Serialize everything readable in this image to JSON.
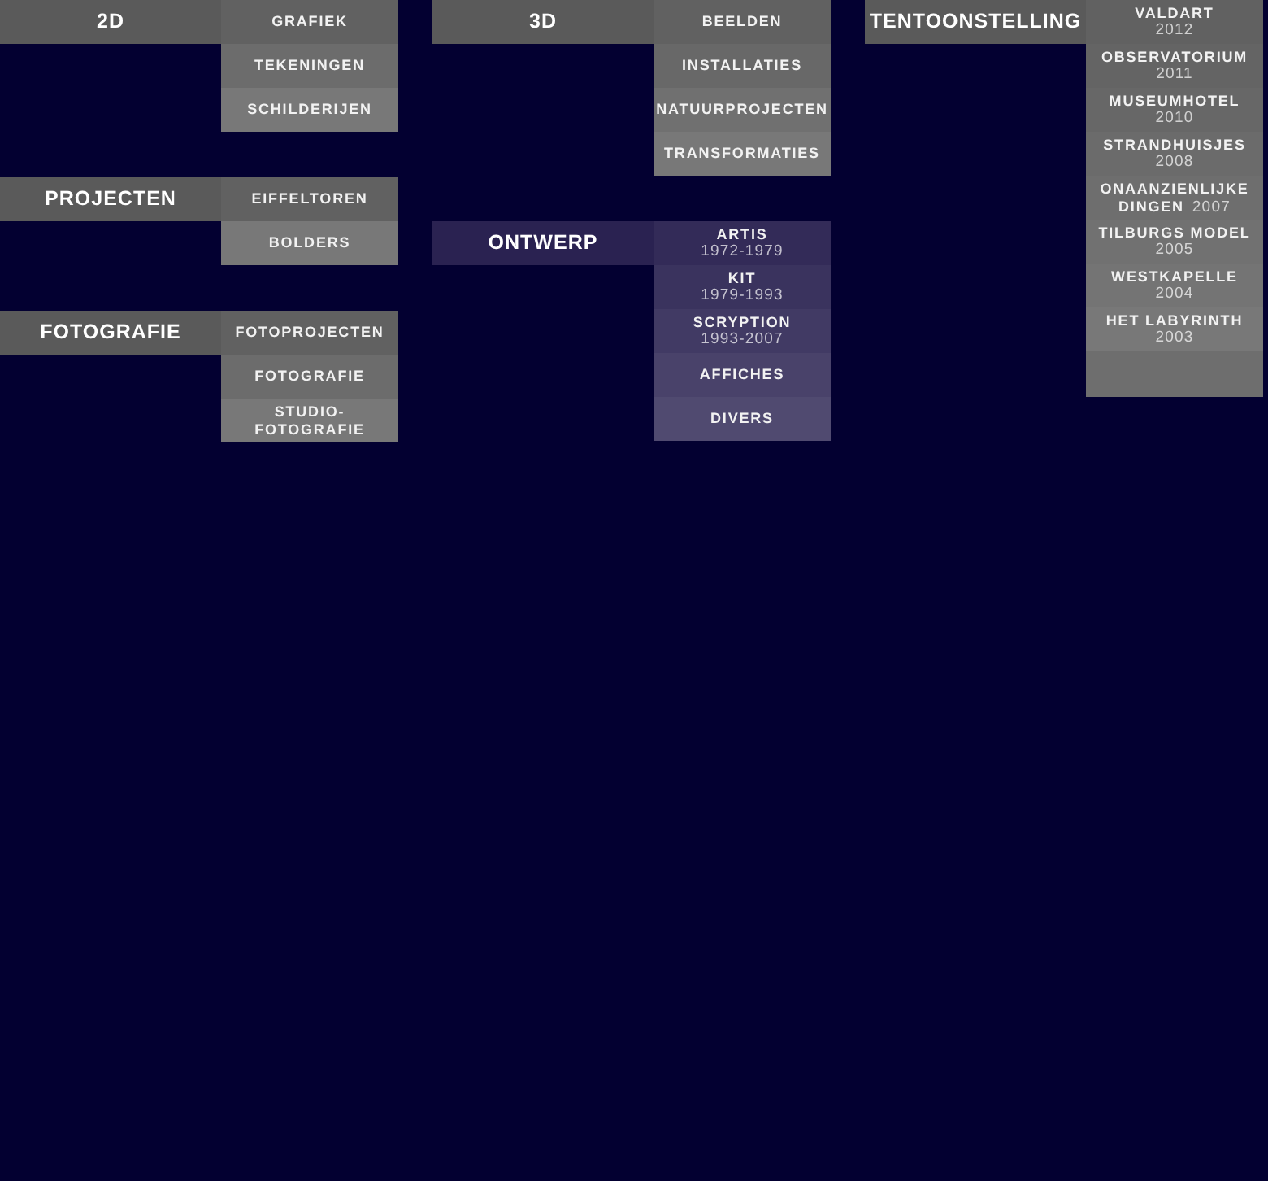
{
  "columns": [
    {
      "groups": [
        {
          "title": "2D",
          "color": "#5a5a5a",
          "items": [
            {
              "label": "GRAFIEK"
            },
            {
              "label": "TEKENINGEN"
            },
            {
              "label": "SCHILDERIJEN"
            }
          ]
        },
        {
          "title": "PROJECTEN",
          "color": "#5a5a5a",
          "items": [
            {
              "label": "EIFFELTOREN"
            },
            {
              "label": "BOLDERS"
            }
          ]
        },
        {
          "title": "FOTOGRAFIE",
          "color": "#5a5a5a",
          "items": [
            {
              "label": "FOTOPROJECTEN"
            },
            {
              "label": "FOTOGRAFIE"
            },
            {
              "label": "STUDIO-FOTOGRAFIE"
            }
          ]
        }
      ]
    },
    {
      "groups": [
        {
          "title": "3D",
          "color": "#5a5a5a",
          "items": [
            {
              "label": "BEELDEN"
            },
            {
              "label": "INSTALLATIES"
            },
            {
              "label": "NATUURPROJECTEN"
            },
            {
              "label": "TRANSFORMATIES"
            }
          ]
        },
        {
          "title": "ONTWERP",
          "color": "#2a2251",
          "items": [
            {
              "kind": "dated",
              "label": "ARTIS",
              "date": "1972-1979"
            },
            {
              "kind": "dated",
              "label": "KIT",
              "date": "1979-1993"
            },
            {
              "kind": "dated",
              "label": "SCRYPTION",
              "date": "1993-2007"
            },
            {
              "kind": "plain",
              "label": "AFFICHES"
            },
            {
              "kind": "plain",
              "label": "DIVERS"
            }
          ]
        }
      ]
    },
    {
      "groups": [
        {
          "title": "TENTOONSTELLING",
          "color": "#5a5a5a",
          "trailing_blank": true,
          "items": [
            {
              "kind": "dated",
              "label": "VALDART",
              "date": "2012"
            },
            {
              "kind": "dated",
              "label": "OBSERVATORIUM",
              "date": "2011"
            },
            {
              "kind": "dated",
              "label": "MUSEUMHOTEL",
              "date": "2010"
            },
            {
              "kind": "dated",
              "label": "STRANDHUISJES",
              "date": "2008"
            },
            {
              "kind": "run-on",
              "label": "ONAANZIENLIJKE DINGEN",
              "date": "2007"
            },
            {
              "kind": "dated",
              "label": "TILBURGS MODEL",
              "date": "2005"
            },
            {
              "kind": "dated",
              "label": "WESTKAPELLE",
              "date": "2004"
            },
            {
              "kind": "dated",
              "label": "HET LABYRINTH",
              "date": "2003"
            }
          ]
        }
      ]
    }
  ]
}
